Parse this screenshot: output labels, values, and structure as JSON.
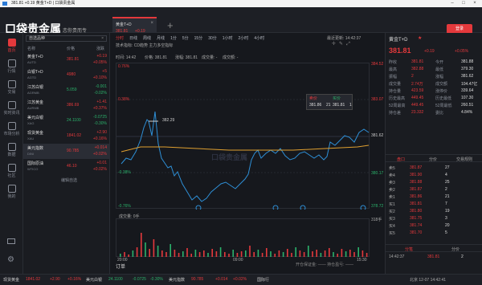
{
  "window": {
    "title": "381.81 +0.19 黄金T+D | 口袋贵金属"
  },
  "brand": {
    "logo": "口袋贵金属",
    "slogan": "恋你贵而专"
  },
  "tab": {
    "name": "黄金T+D",
    "price": "381.81",
    "change": "+0.19"
  },
  "header": {
    "login": "登录"
  },
  "nav": [
    {
      "label": "首页",
      "icon": "home-icon"
    },
    {
      "label": "行情",
      "icon": "quote-icon"
    },
    {
      "label": "交易",
      "icon": "trade-icon"
    },
    {
      "label": "实时资讯",
      "icon": "news-icon"
    },
    {
      "label": "市场分析",
      "icon": "analysis-icon"
    },
    {
      "label": "数据",
      "icon": "data-icon"
    },
    {
      "label": "社区",
      "icon": "community-icon"
    },
    {
      "label": "我的",
      "icon": "user-icon"
    }
  ],
  "watch": {
    "title": "自选品种",
    "col_name": "名称",
    "col_price": "价格",
    "col_change": "涨跌",
    "rows": [
      {
        "name": "黄金T+D",
        "code": "AUTD",
        "price": "381.81",
        "chg": "+0.19",
        "pct": "+0.05%",
        "dir": "up"
      },
      {
        "name": "白银T+D",
        "code": "AGTD",
        "price": "4980",
        "chg": "+5",
        "pct": "+0.10%",
        "dir": "up"
      },
      {
        "name": "江苏白银",
        "code": "AGRMB",
        "price": "5.059",
        "chg": "-0.001",
        "pct": "-0.02%",
        "dir": "dn"
      },
      {
        "name": "江苏黄金",
        "code": "AURMB",
        "price": "386.69",
        "chg": "+1.41",
        "pct": "+0.37%",
        "dir": "up"
      },
      {
        "name": "美元白银",
        "code": "XAG",
        "price": "24.1100",
        "chg": "-0.0725",
        "pct": "-0.30%",
        "dir": "dn"
      },
      {
        "name": "现货黄金",
        "code": "XAU",
        "price": "1841.02",
        "chg": "+2.90",
        "pct": "+0.16%",
        "dir": "up"
      },
      {
        "name": "美元指数",
        "code": "DINI",
        "price": "90.785",
        "chg": "+0.014",
        "pct": "+0.02%",
        "dir": "up"
      },
      {
        "name": "国际原油",
        "code": "WTICO",
        "price": "46.10",
        "chg": "+0.01",
        "pct": "+0.02%",
        "dir": "up"
      }
    ],
    "edit": "编辑自选"
  },
  "chart": {
    "periods": [
      "分时",
      "日线",
      "周线",
      "月线",
      "1分",
      "5分",
      "15分",
      "30分",
      "1小时",
      "2小时",
      "4小时"
    ],
    "update_label": "最近更新: 14:42:37",
    "tools": "技术指标:  CD趋势     主力多空指标",
    "info": {
      "time": "时间: 14:42",
      "price": "价格: 381.81",
      "chg": "涨幅: 381.81",
      "vol": "成交量: -",
      "hold": "成交额: -"
    },
    "watermark": "口袋贵金属",
    "ylabels_left": [
      "0.76%",
      "0.38%",
      "-0.38%",
      "-0.76%"
    ],
    "ylabels_right": [
      "384.52",
      "383.07",
      "381.62",
      "380.17",
      "378.72"
    ],
    "marker": "382.29",
    "sell_label": "卖价",
    "sell_price": "381.86",
    "sell_vol": "21",
    "buy_label": "买价",
    "buy_price": "381.81",
    "buy_vol": "1",
    "vol_label": "成交量: 0手",
    "vol_right": "318手",
    "xlabels": [
      "20:00",
      "09:00",
      "15:30"
    ],
    "orders": "订单",
    "orders_right": "开仓保证金: ——    持仓盈亏: ——",
    "chart_data": {
      "type": "line",
      "title": "",
      "series": [
        {
          "name": "价格"
        },
        {
          "name": "均价"
        }
      ],
      "ylim": [
        378.72,
        384.52
      ]
    }
  },
  "quote": {
    "name": "黄金T+D",
    "price": "381.81",
    "change": "+0.19",
    "pct": "+0.05%",
    "stats": [
      [
        "昨收",
        "381.81",
        "今开",
        "381.88"
      ],
      [
        "最高",
        "382.88",
        "最低",
        "379.30"
      ],
      [
        "振幅",
        "2",
        "涨幅",
        "381.62"
      ],
      [
        "成交量",
        "2.74万",
        "成交额",
        "104.47亿"
      ],
      [
        "持仓量",
        "423.59",
        "涨停价",
        "339.64"
      ],
      [
        "历史最高",
        "449.45",
        "历史最低",
        "107.30"
      ],
      [
        "52周最高",
        "449.45",
        "52周最低",
        "260.51"
      ],
      [
        "持仓差",
        "23.332",
        "委比",
        "4.84%"
      ]
    ],
    "tabs": [
      "盘口",
      "分价",
      "交易规则"
    ],
    "asks": [
      [
        "卖5",
        "381.87",
        "27"
      ],
      [
        "卖4",
        "381.90",
        "4"
      ],
      [
        "卖3",
        "381.88",
        "25"
      ],
      [
        "卖2",
        "381.87",
        "2"
      ],
      [
        "卖1",
        "381.86",
        "21"
      ]
    ],
    "bids": [
      [
        "买1",
        "381.81",
        "7"
      ],
      [
        "买2",
        "381.80",
        "19"
      ],
      [
        "买3",
        "381.75",
        "3"
      ],
      [
        "买4",
        "381.74",
        "20"
      ],
      [
        "买5",
        "381.70",
        "5"
      ]
    ],
    "trade_tabs": [
      "分笔",
      "分价"
    ],
    "trade": [
      "14:42:37",
      "381.81",
      "2"
    ]
  },
  "status": {
    "items": [
      [
        "现货黄金",
        "1841.02",
        "+2.90",
        "+0.16%"
      ],
      [
        "美元白银",
        "24.1100",
        "-0.0725",
        "-0.30%"
      ],
      [
        "美元指数",
        "90.785",
        "+0.014",
        "+0.02%"
      ]
    ],
    "more": "国际行",
    "right": "北京 12-07 14:42:41"
  },
  "colors": {
    "up": "#e4393c",
    "down": "#2bb26b",
    "accent": "#e4393c"
  }
}
